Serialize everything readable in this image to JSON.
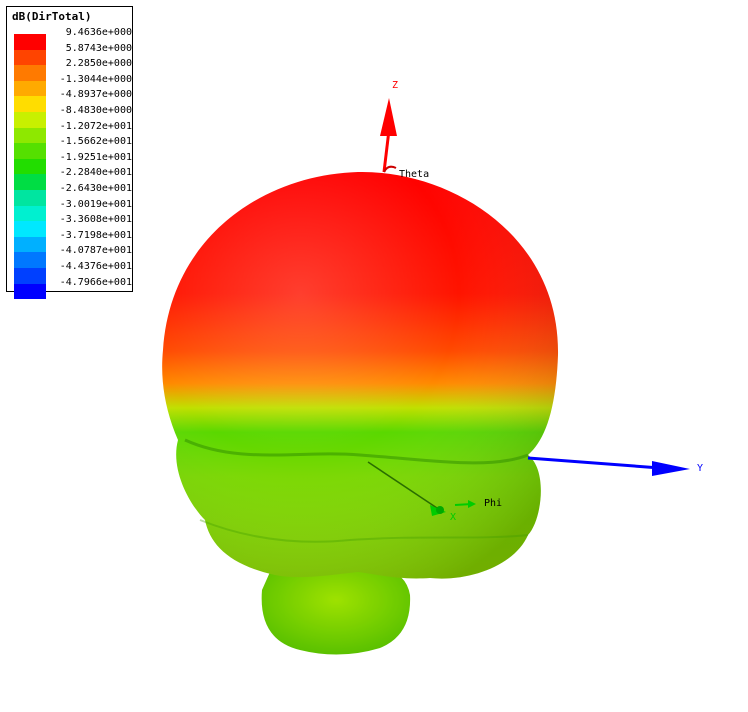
{
  "legend": {
    "title": "dB(DirTotal)",
    "entries": [
      {
        "value": "9.4636e+000",
        "color": "#ff0000"
      },
      {
        "value": "5.8743e+000",
        "color": "#ff4400"
      },
      {
        "value": "2.2850e+000",
        "color": "#ff7a00"
      },
      {
        "value": "-1.3044e+000",
        "color": "#ffaa00"
      },
      {
        "value": "-4.8937e+000",
        "color": "#ffdd00"
      },
      {
        "value": "-8.4830e+000",
        "color": "#c8f000"
      },
      {
        "value": "-1.2072e+001",
        "color": "#8ee800"
      },
      {
        "value": "-1.5662e+001",
        "color": "#55e000"
      },
      {
        "value": "-1.9251e+001",
        "color": "#22dd00"
      },
      {
        "value": "-2.2840e+001",
        "color": "#00dd44"
      },
      {
        "value": "-2.6430e+001",
        "color": "#00e5a0"
      },
      {
        "value": "-3.0019e+001",
        "color": "#00f0d0"
      },
      {
        "value": "-3.3608e+001",
        "color": "#00e8ff"
      },
      {
        "value": "-3.7198e+001",
        "color": "#00b0ff"
      },
      {
        "value": "-4.0787e+001",
        "color": "#0078ff"
      },
      {
        "value": "-4.4376e+001",
        "color": "#0040ff"
      },
      {
        "value": "-4.7966e+001",
        "color": "#0000ff"
      }
    ]
  },
  "axes": {
    "z_label": "Z",
    "y_label": "Y",
    "x_label": "X",
    "theta_label": "Theta",
    "phi_label": "Phi",
    "z_color": "#ff0000",
    "y_color": "#0000ff",
    "x_color": "#00cc00"
  }
}
